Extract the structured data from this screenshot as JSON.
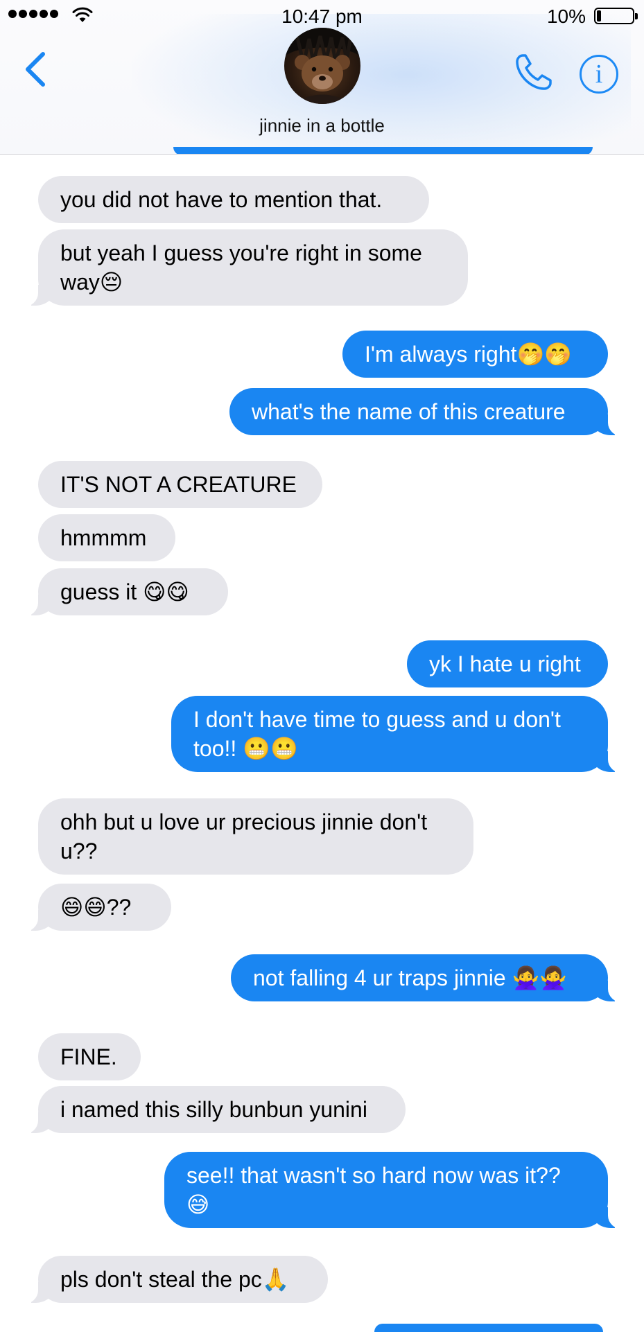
{
  "status_bar": {
    "time": "10:47 pm",
    "battery_percent": "10%",
    "battery_level": 0.1,
    "signal_bars": 5
  },
  "header": {
    "contact_name": "jinnie in a bottle",
    "back_icon": "chevron-left-icon",
    "call_icon": "phone-icon",
    "info_icon": "info-icon",
    "info_glyph": "i",
    "accent_color": "#1a86f2"
  },
  "messages": [
    {
      "direction": "in",
      "text": "you did not have to mention that."
    },
    {
      "direction": "in",
      "text": "but yeah I guess you're right in some way😔"
    },
    {
      "direction": "out",
      "text": "I'm always right🤭🤭"
    },
    {
      "direction": "out",
      "text": "what's the name of this creature"
    },
    {
      "direction": "in",
      "text": "IT'S NOT A CREATURE"
    },
    {
      "direction": "in",
      "text": "hmmmm"
    },
    {
      "direction": "in",
      "text": "guess it 😋😋"
    },
    {
      "direction": "out",
      "text": "yk I hate u right"
    },
    {
      "direction": "out",
      "text": "I don't have time to guess and u don't too!! 😬😬"
    },
    {
      "direction": "in",
      "text": "ohh but u love ur precious jinnie don't u??"
    },
    {
      "direction": "in",
      "text": "😄😄??"
    },
    {
      "direction": "out",
      "text": "not falling 4 ur traps jinnie 🙅‍♀️🙅‍♀️"
    },
    {
      "direction": "in",
      "text": "FINE."
    },
    {
      "direction": "in",
      "text": "i named this silly bunbun yunini"
    },
    {
      "direction": "out",
      "text": "see!! that wasn't so hard now was it?? 😅"
    },
    {
      "direction": "in",
      "text": "pls don't steal the pc🙏"
    }
  ],
  "colors": {
    "incoming_bubble": "#e6e6eb",
    "outgoing_bubble": "#1a86f2"
  }
}
